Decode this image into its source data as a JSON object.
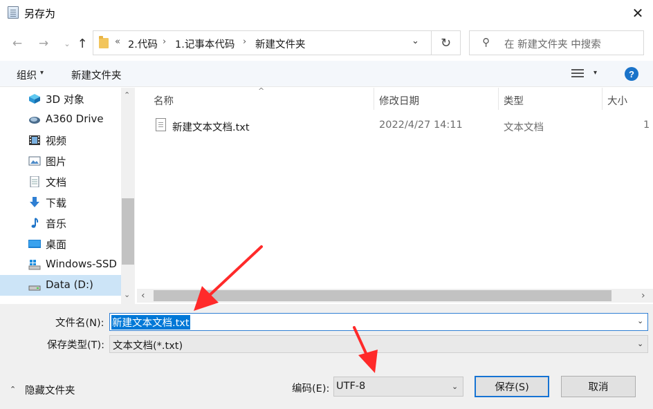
{
  "window": {
    "title": "另存为",
    "close_glyph": "✕"
  },
  "nav": {
    "back_glyph": "←",
    "forward_glyph": "→",
    "recent_glyph": "⌄",
    "up_glyph": "↑",
    "breadcrumb_lead": "«",
    "breadcrumbs": [
      "2.代码",
      "1.记事本代码",
      "新建文件夹"
    ],
    "crumb_sep": "›",
    "dropdown_glyph": "⌄",
    "refresh_glyph": "↻",
    "search_glyph": "⚲",
    "search_placeholder": "在 新建文件夹 中搜索"
  },
  "toolbar": {
    "organize_label": "组织",
    "organize_caret": "▾",
    "new_folder_label": "新建文件夹",
    "view_caret": "▾",
    "help_label": "?"
  },
  "sidebar": {
    "items": [
      {
        "label": "3D 对象",
        "icon": "3d-objects-icon"
      },
      {
        "label": "A360 Drive",
        "icon": "cloud-drive-icon"
      },
      {
        "label": "视频",
        "icon": "video-icon"
      },
      {
        "label": "图片",
        "icon": "pictures-icon"
      },
      {
        "label": "文档",
        "icon": "documents-icon"
      },
      {
        "label": "下载",
        "icon": "download-icon"
      },
      {
        "label": "音乐",
        "icon": "music-icon"
      },
      {
        "label": "桌面",
        "icon": "desktop-icon"
      },
      {
        "label": "Windows-SSD (",
        "icon": "windows-drive-icon"
      },
      {
        "label": "Data (D:)",
        "icon": "data-drive-icon",
        "selected": true
      }
    ],
    "scroll_up": "⌃",
    "scroll_down": "⌄"
  },
  "filelist": {
    "columns": {
      "name": "名称",
      "modified": "修改日期",
      "type": "类型",
      "size": "大小"
    },
    "sort_caret": "^",
    "rows": [
      {
        "name": "新建文本文档.txt",
        "modified": "2022/4/27 14:11",
        "type": "文本文档",
        "size": "1"
      }
    ],
    "scroll_left": "‹",
    "scroll_right": "›"
  },
  "form": {
    "filename_label": "文件名(N):",
    "filename_value": "新建文本文档.txt",
    "filetype_label": "保存类型(T):",
    "filetype_value": "文本文档(*.txt)",
    "caret": "⌄",
    "hide_folders_caret": "⌃",
    "hide_folders_label": "隐藏文件夹",
    "encoding_label": "编码(E):",
    "encoding_value": "UTF-8",
    "save_label": "保存(S)",
    "cancel_label": "取消"
  },
  "colors": {
    "accent": "#0078d7",
    "annotation_arrow": "#ff2a2a",
    "selected_row": "#cce4f7"
  }
}
